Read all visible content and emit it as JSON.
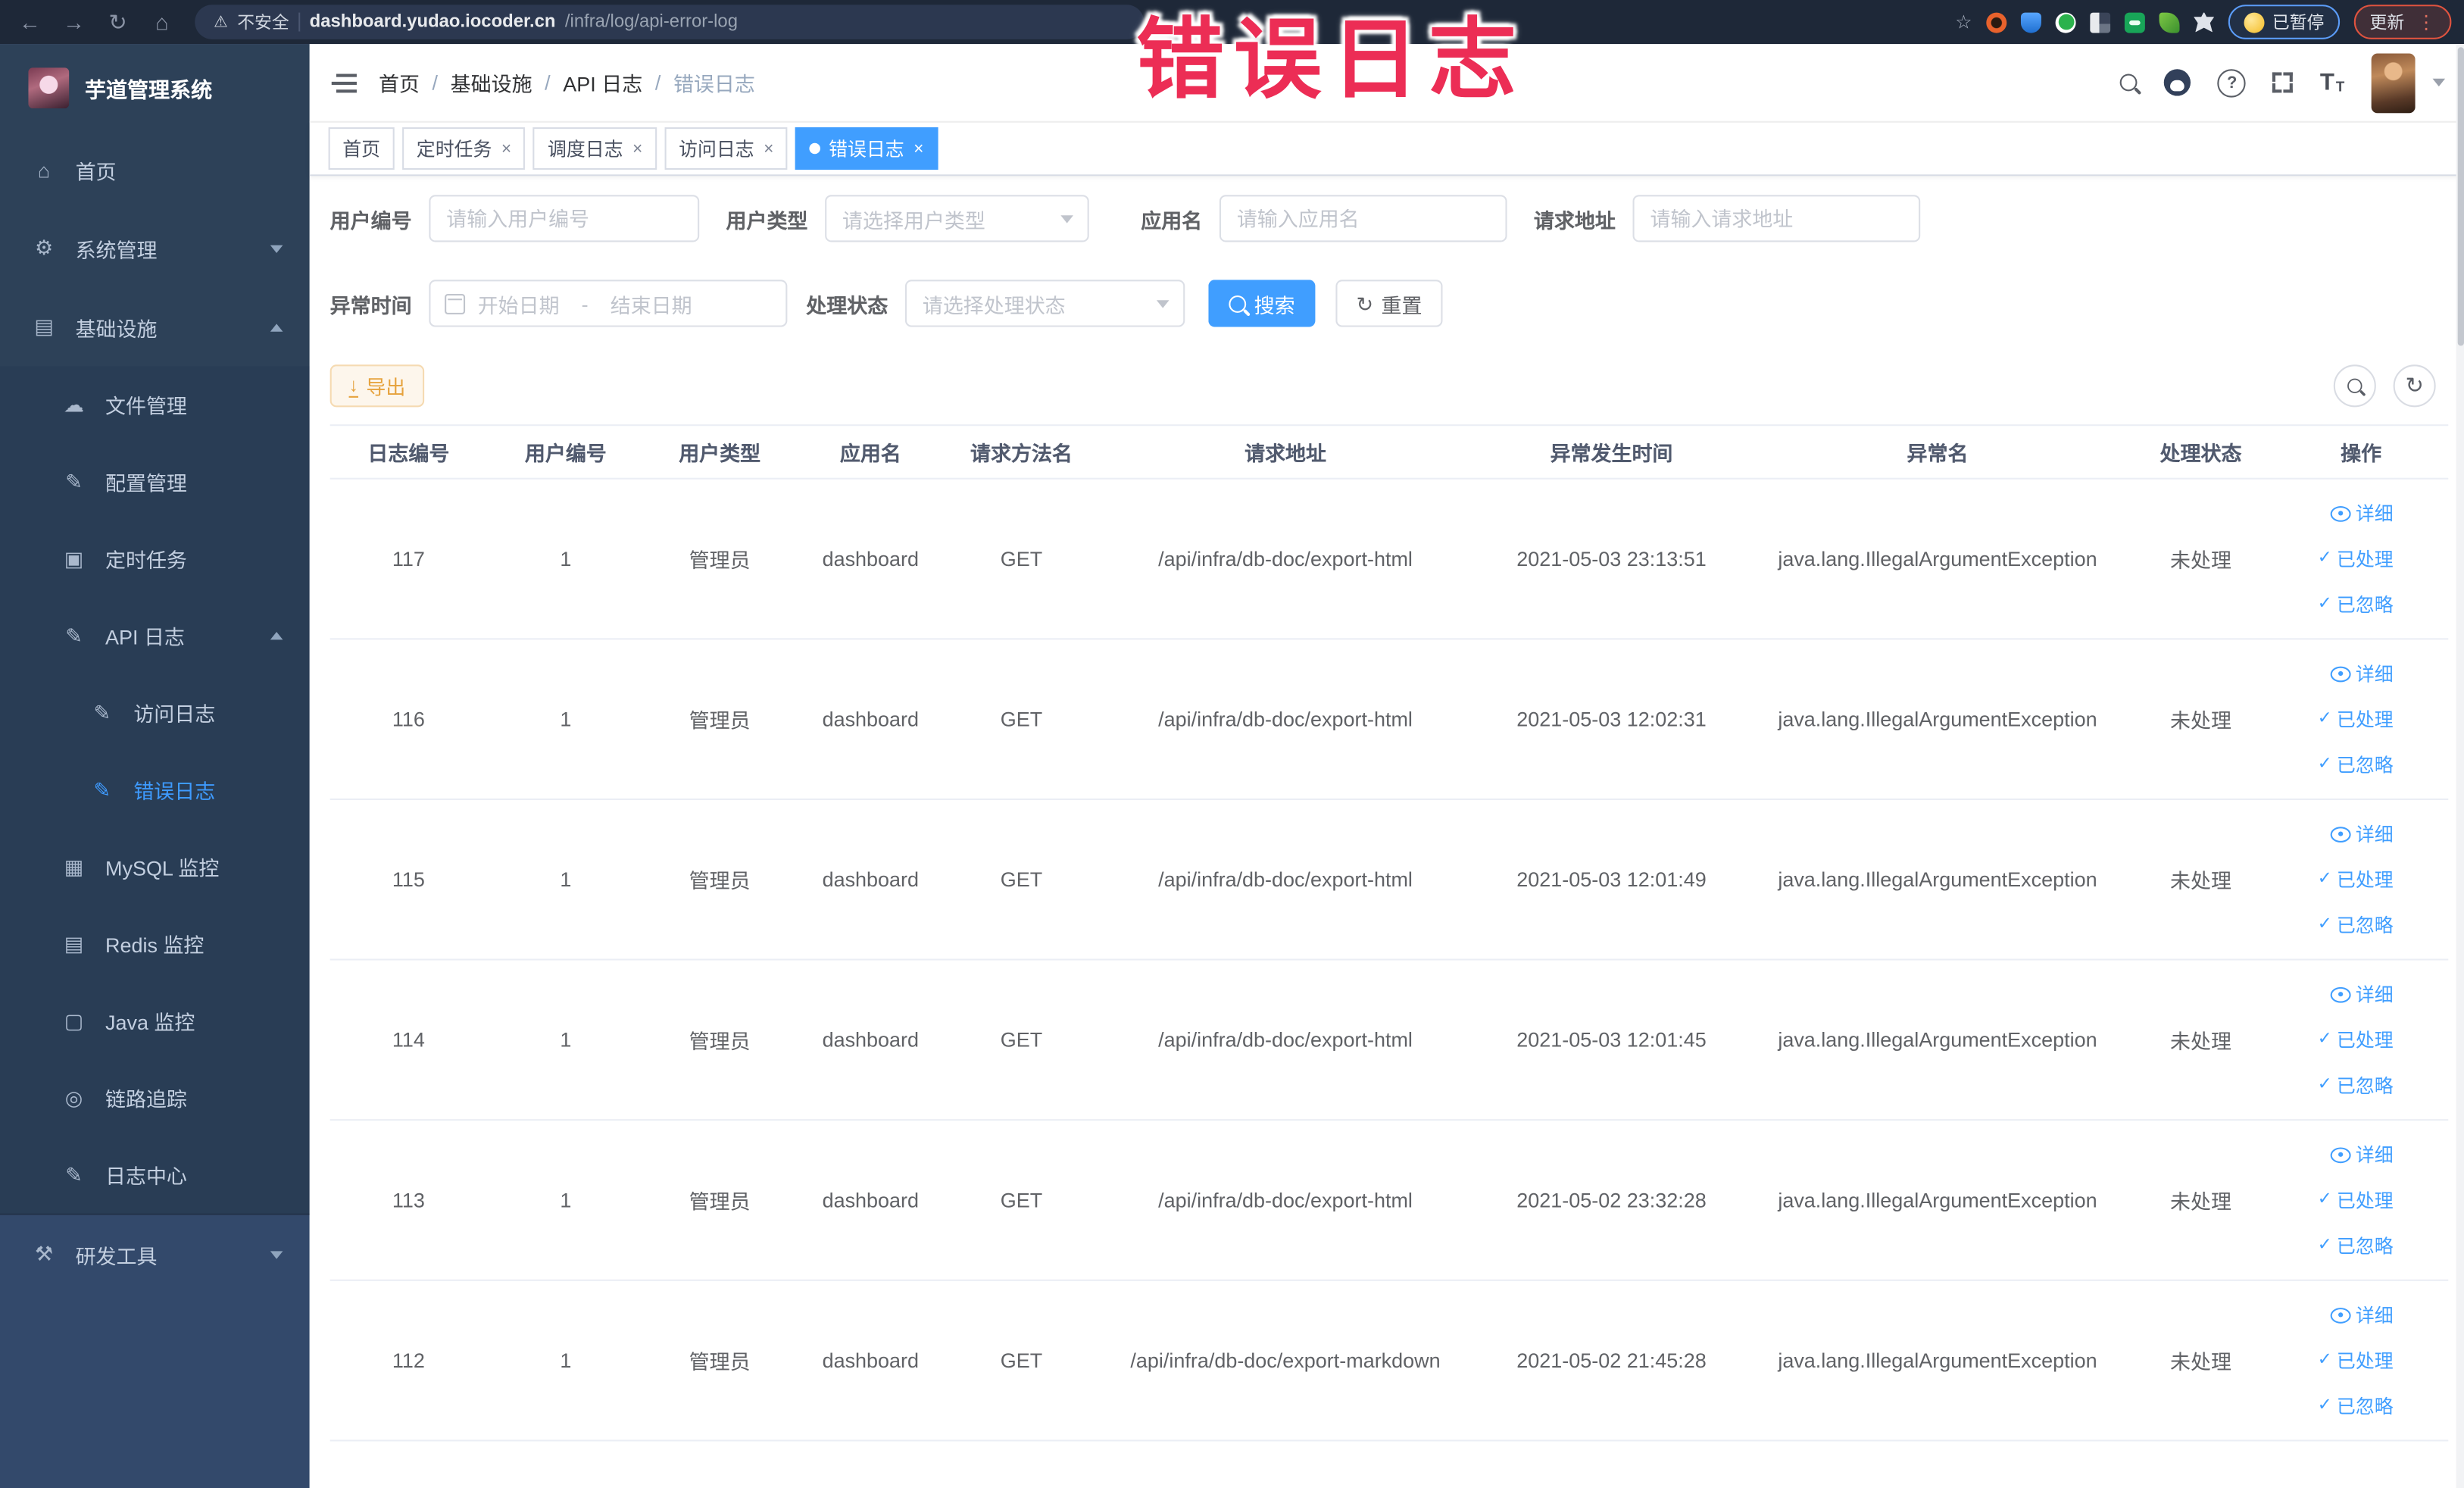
{
  "overlay": {
    "title": "错误日志"
  },
  "icons": {
    "back": "←",
    "forward": "→",
    "reload": "↻",
    "home_glyph": "⌂",
    "warning": "⚠",
    "star": "☆",
    "question": "?",
    "dots": "⋮",
    "refresh": "↻",
    "close": "×",
    "check": "✓",
    "font_large": "T",
    "font_small": "T",
    "sidebar_home": "⌂",
    "sidebar_gear": "⚙",
    "sidebar_infra": "▤",
    "sidebar_cloud": "☁",
    "sidebar_edit": "✎",
    "sidebar_task": "▣",
    "sidebar_mysql": "▦",
    "sidebar_redis": "▤",
    "sidebar_java": "▢",
    "sidebar_trace": "◎",
    "sidebar_log": "✎",
    "sidebar_tools": "⚒"
  },
  "browser": {
    "security_label": "不安全",
    "url_host": "dashboard.yudao.iocoder.cn",
    "url_path": "/infra/log/api-error-log",
    "paused_badge": "已暂停",
    "update_button": "更新"
  },
  "sidebar": {
    "app_title": "芋道管理系统",
    "items": [
      {
        "label": "首页"
      },
      {
        "label": "系统管理"
      },
      {
        "label": "基础设施"
      },
      {
        "label": "文件管理"
      },
      {
        "label": "配置管理"
      },
      {
        "label": "定时任务"
      },
      {
        "label": "API 日志"
      },
      {
        "label": "访问日志"
      },
      {
        "label": "错误日志"
      },
      {
        "label": "MySQL 监控"
      },
      {
        "label": "Redis 监控"
      },
      {
        "label": "Java 监控"
      },
      {
        "label": "链路追踪"
      },
      {
        "label": "日志中心"
      },
      {
        "label": "研发工具"
      }
    ]
  },
  "breadcrumb": {
    "separator": "/",
    "items": [
      "首页",
      "基础设施",
      "API 日志",
      "错误日志"
    ]
  },
  "tags": [
    {
      "label": "首页"
    },
    {
      "label": "定时任务"
    },
    {
      "label": "调度日志"
    },
    {
      "label": "访问日志"
    },
    {
      "label": "错误日志"
    }
  ],
  "filters": {
    "user_id": {
      "label": "用户编号",
      "placeholder": "请输入用户编号"
    },
    "user_type": {
      "label": "用户类型",
      "placeholder": "请选择用户类型"
    },
    "app_name": {
      "label": "应用名",
      "placeholder": "请输入应用名"
    },
    "request_url": {
      "label": "请求地址",
      "placeholder": "请输入请求地址"
    },
    "exception_time": {
      "label": "异常时间",
      "start_placeholder": "开始日期",
      "separator": "-",
      "end_placeholder": "结束日期"
    },
    "process_status": {
      "label": "处理状态",
      "placeholder": "请选择处理状态"
    },
    "search_button": "搜索",
    "reset_button": "重置"
  },
  "toolbar": {
    "export_button": "导出"
  },
  "table": {
    "columns": [
      "日志编号",
      "用户编号",
      "用户类型",
      "应用名",
      "请求方法名",
      "请求地址",
      "异常发生时间",
      "异常名",
      "处理状态",
      "操作"
    ],
    "actions": [
      "详细",
      "已处理",
      "已忽略"
    ],
    "rows": [
      {
        "id": "117",
        "user_id": "1",
        "user_type": "管理员",
        "app": "dashboard",
        "method": "GET",
        "url": "/api/infra/db-doc/export-html",
        "time": "2021-05-03 23:13:51",
        "exception": "java.lang.IllegalArgumentException",
        "status": "未处理"
      },
      {
        "id": "116",
        "user_id": "1",
        "user_type": "管理员",
        "app": "dashboard",
        "method": "GET",
        "url": "/api/infra/db-doc/export-html",
        "time": "2021-05-03 12:02:31",
        "exception": "java.lang.IllegalArgumentException",
        "status": "未处理"
      },
      {
        "id": "115",
        "user_id": "1",
        "user_type": "管理员",
        "app": "dashboard",
        "method": "GET",
        "url": "/api/infra/db-doc/export-html",
        "time": "2021-05-03 12:01:49",
        "exception": "java.lang.IllegalArgumentException",
        "status": "未处理"
      },
      {
        "id": "114",
        "user_id": "1",
        "user_type": "管理员",
        "app": "dashboard",
        "method": "GET",
        "url": "/api/infra/db-doc/export-html",
        "time": "2021-05-03 12:01:45",
        "exception": "java.lang.IllegalArgumentException",
        "status": "未处理"
      },
      {
        "id": "113",
        "user_id": "1",
        "user_type": "管理员",
        "app": "dashboard",
        "method": "GET",
        "url": "/api/infra/db-doc/export-html",
        "time": "2021-05-02 23:32:28",
        "exception": "java.lang.IllegalArgumentException",
        "status": "未处理"
      },
      {
        "id": "112",
        "user_id": "1",
        "user_type": "管理员",
        "app": "dashboard",
        "method": "GET",
        "url": "/api/infra/db-doc/export-markdown",
        "time": "2021-05-02 21:45:28",
        "exception": "java.lang.IllegalArgumentException",
        "status": "未处理"
      }
    ]
  }
}
